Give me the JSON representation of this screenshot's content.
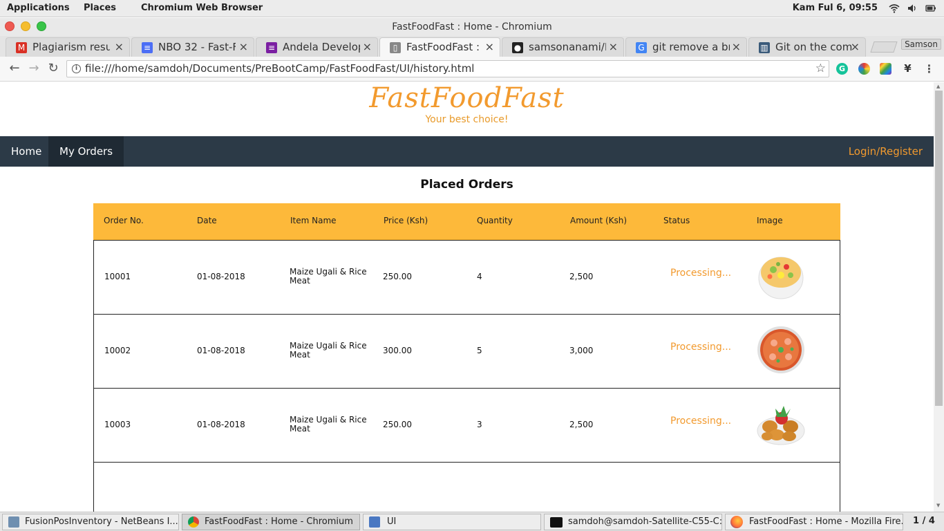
{
  "desktop": {
    "menu": [
      "Applications",
      "Places",
      "Chromium Web Browser"
    ],
    "clock": "Kam Ful  6, 09:55"
  },
  "window": {
    "title": "FastFoodFast : Home - Chromium"
  },
  "tabs": [
    {
      "label": "Plagiarism resul",
      "icon": "gmail-icon",
      "color": "#d93025",
      "glyph": "M"
    },
    {
      "label": "NBO 32 - Fast-F",
      "icon": "docs-icon",
      "color": "#4c6ef5",
      "glyph": "≡"
    },
    {
      "label": "Andela Develop",
      "icon": "forms-icon",
      "color": "#7b1fa2",
      "glyph": "≡"
    },
    {
      "label": "FastFoodFast : H",
      "icon": "page-icon",
      "color": "#888888",
      "glyph": "▯"
    },
    {
      "label": "samsonanami/F",
      "icon": "github-icon",
      "color": "#222222",
      "glyph": "●"
    },
    {
      "label": "git remove a br",
      "icon": "google-icon",
      "color": "#4285f4",
      "glyph": "G"
    },
    {
      "label": "Git on the comm",
      "icon": "book-icon",
      "color": "#3a5a7a",
      "glyph": "▥"
    }
  ],
  "profile": "Samson",
  "address": "file:///home/samdoh/Documents/PreBootCamp/FastFoodFast/UI/history.html",
  "page": {
    "brand": "FastFoodFast",
    "tagline": "Your best choice!",
    "nav": {
      "home": "Home",
      "orders": "My Orders",
      "login": "Login/Register"
    },
    "heading": "Placed Orders",
    "columns": [
      "Order No.",
      "Date",
      "Item Name",
      "Price (Ksh)",
      "Quantity",
      "Amount (Ksh)",
      "Status",
      "Image"
    ],
    "rows": [
      {
        "order": "10001",
        "date": "01-08-2018",
        "item": "Maize Ugali & Rice Meat",
        "price": "250.00",
        "qty": "4",
        "amount": "2,500",
        "status": "Processing...",
        "image": "noodle-bowl-icon"
      },
      {
        "order": "10002",
        "date": "01-08-2018",
        "item": "Maize Ugali & Rice Meat",
        "price": "300.00",
        "qty": "5",
        "amount": "3,000",
        "status": "Processing...",
        "image": "pizza-icon"
      },
      {
        "order": "10003",
        "date": "01-08-2018",
        "item": "Maize Ugali & Rice Meat",
        "price": "250.00",
        "qty": "3",
        "amount": "2,500",
        "status": "Processing...",
        "image": "fried-chicken-icon"
      }
    ]
  },
  "taskbar": [
    {
      "label": "FusionPosInventory - NetBeans I...",
      "icon": "netbeans-icon"
    },
    {
      "label": "FastFoodFast : Home - Chromium",
      "icon": "chromium-icon"
    },
    {
      "label": "UI",
      "icon": "folder-icon"
    },
    {
      "label": "samdoh@samdoh-Satellite-C55-C:...",
      "icon": "terminal-icon"
    },
    {
      "label": "FastFoodFast : Home - Mozilla Fire...",
      "icon": "firefox-icon"
    }
  ],
  "workspace": "1 / 4"
}
